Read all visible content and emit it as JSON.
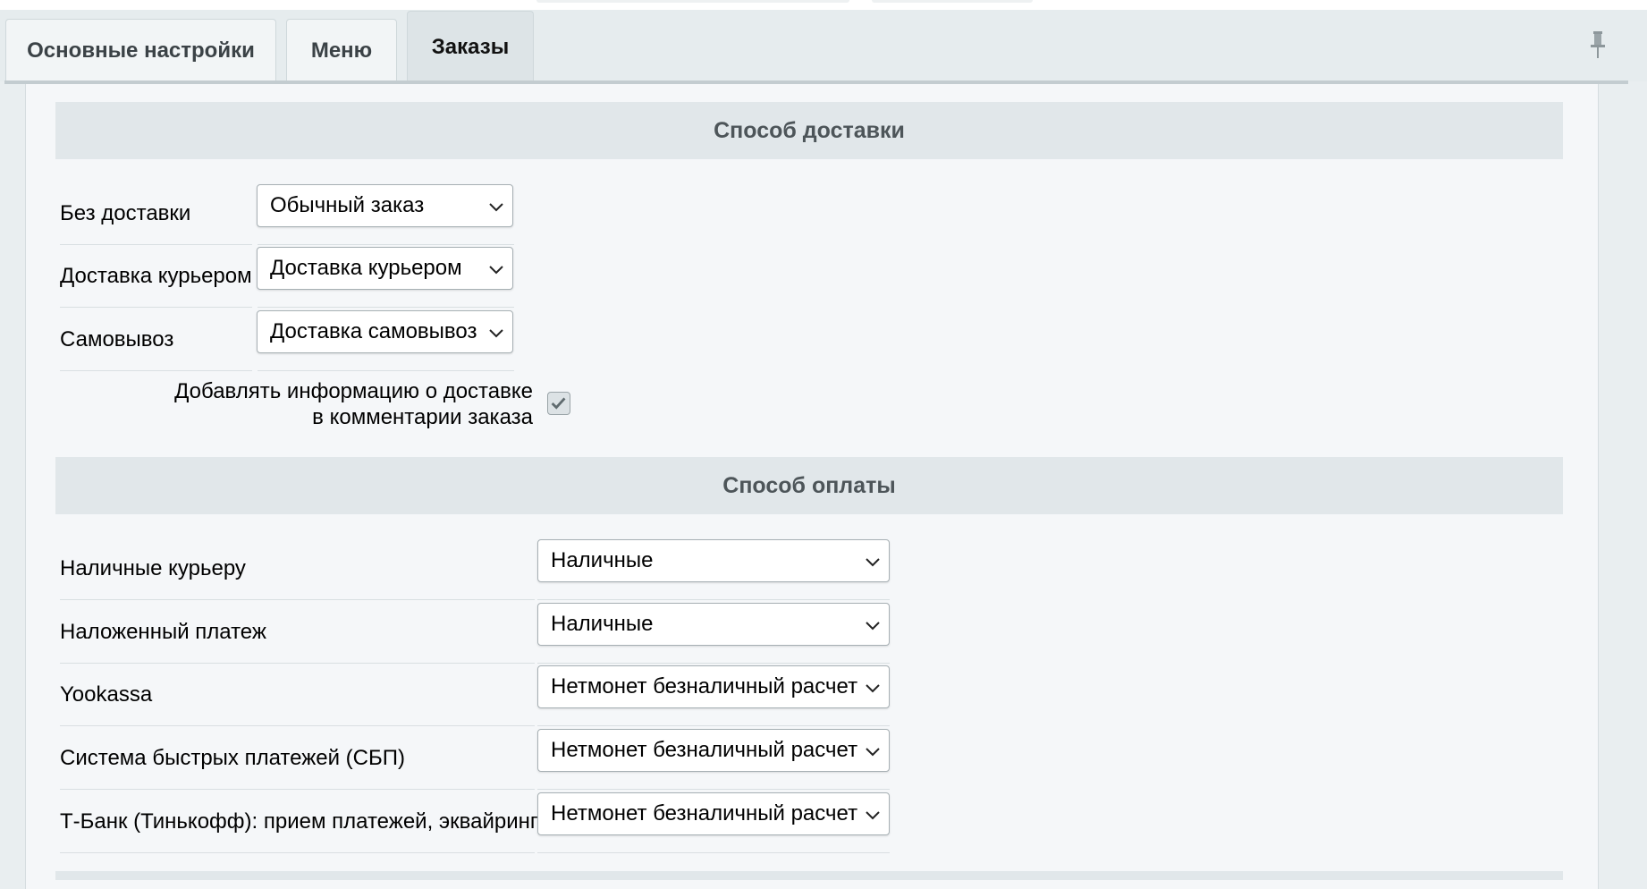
{
  "tabs": [
    {
      "label": "Основные настройки"
    },
    {
      "label": "Меню"
    },
    {
      "label": "Заказы"
    }
  ],
  "active_tab": "Заказы",
  "delivery": {
    "title": "Способ доставки",
    "rows": [
      {
        "label": "Без доставки",
        "value": "Обычный заказ"
      },
      {
        "label": "Доставка курьером",
        "value": "Доставка курьером"
      },
      {
        "label": "Самовывоз",
        "value": "Доставка самовывоз"
      }
    ],
    "comment_option": {
      "line1": "Добавлять информацию о доставке",
      "line2": "в комментарии заказа",
      "checked": true
    }
  },
  "payment": {
    "title": "Способ оплаты",
    "rows": [
      {
        "label": "Наличные курьеру",
        "value": "Наличные"
      },
      {
        "label": "Наложенный платеж",
        "value": "Наличные"
      },
      {
        "label": "Yookassa",
        "value": "Нетмонет безналичный расчет"
      },
      {
        "label": "Система быстрых платежей (СБП)",
        "value": "Нетмонет безналичный расчет"
      },
      {
        "label": "Т-Банк (Тинькофф): прием платежей, эквайринг",
        "value": "Нетмонет безналичный расчет"
      }
    ]
  },
  "icons": {
    "pin": "pin-icon",
    "chevron": "chevron-down-icon",
    "check": "check-icon"
  }
}
